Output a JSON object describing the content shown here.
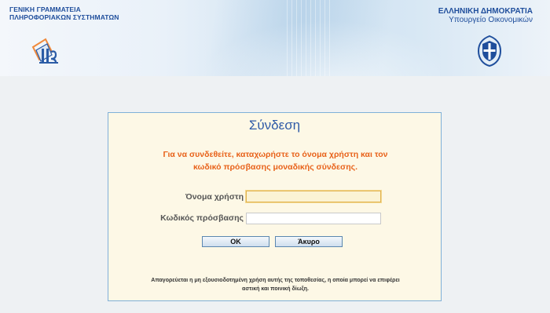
{
  "header": {
    "gsis_line1": "ΓΕΝΙΚΗ ΓΡΑΜΜΑΤΕΙΑ",
    "gsis_line2": "ΠΛΗΡΟΦΟΡΙΑΚΩΝ ΣΥΣΤΗΜΑΤΩΝ",
    "gov_line1": "ΕΛΛΗΝΙΚΗ ΔΗΜΟΚΡΑΤΙΑ",
    "gov_line2": "Υπουργείο Οικονομικών",
    "logo_icon": "gsis-logo-icon",
    "emblem_icon": "hellenic-emblem-icon"
  },
  "login": {
    "title": "Σύνδεση",
    "instruction_line1": "Για να συνδεθείτε, καταχωρήστε το όνομα χρήστη και τον",
    "instruction_line2": "κωδικό πρόσβασης μοναδικής σύνδεσης.",
    "username_label": "Όνομα χρήστη",
    "username_value": "",
    "password_label": "Κωδικός πρόσβασης",
    "password_value": "",
    "ok_label": "OK",
    "cancel_label": "Άκυρο",
    "disclaimer_line1": "Απαγορεύεται η μη εξουσιοδοτημένη χρήση αυτής της τοποθεσίας, η οποία μπορεί να επιφέρει",
    "disclaimer_line2": "αστική και ποινική δίωξη."
  },
  "colors": {
    "brand_blue": "#1f4e9c",
    "instruction_orange": "#e8621a",
    "panel_background": "#fdf8e6",
    "panel_border": "#7fb0d8"
  }
}
